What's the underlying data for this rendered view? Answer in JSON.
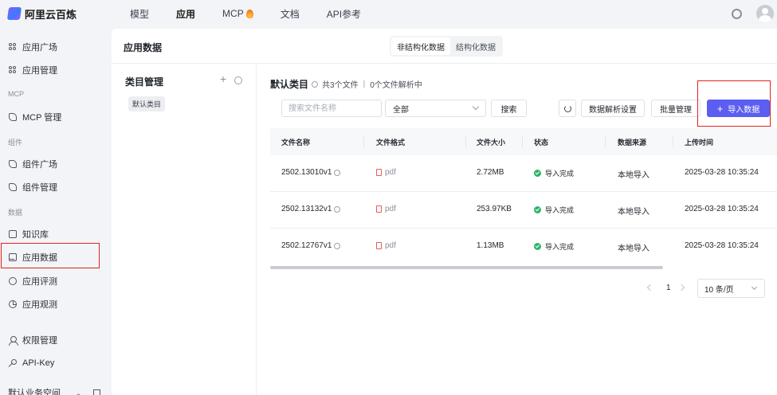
{
  "brand": {
    "name": "阿里云百炼"
  },
  "nav": {
    "items": [
      {
        "label": "模型",
        "active": false
      },
      {
        "label": "应用",
        "active": true
      },
      {
        "label": "MCP",
        "active": false
      },
      {
        "label": "文档",
        "active": false
      },
      {
        "label": "API参考",
        "active": false
      }
    ]
  },
  "sidebar": {
    "app_square": "应用广场",
    "app_manage": "应用管理",
    "section_mcp": "MCP",
    "mcp_manage": "MCP 管理",
    "section_component": "组件",
    "component_square": "组件广场",
    "component_manage": "组件管理",
    "section_data": "数据",
    "knowledge": "知识库",
    "app_data": "应用数据",
    "app_eval": "应用评测",
    "app_observe": "应用观测",
    "permission": "权限管理",
    "api_key": "API-Key",
    "workspace": "默认业务空间"
  },
  "main": {
    "title": "应用数据",
    "tabs": [
      {
        "label": "非结构化数据",
        "active": true
      },
      {
        "label": "结构化数据",
        "active": false
      }
    ]
  },
  "category": {
    "title": "类目管理",
    "add": "+",
    "default_tag": "默认类目"
  },
  "content": {
    "current_category": "默认类目",
    "file_count": "共3个文件",
    "parsing_count": "0个文件解析中",
    "search_placeholder": "搜索文件名称",
    "filter_value": "全部",
    "search_button": "搜索",
    "parse_settings_button": "数据解析设置",
    "batch_button": "批量管理",
    "import_button": "导入数据"
  },
  "table": {
    "columns": [
      "文件名称",
      "文件格式",
      "文件大小",
      "状态",
      "数据来源",
      "上传时间"
    ],
    "rows": [
      {
        "name": "2502.13010v1",
        "format": "pdf",
        "size": "2.72MB",
        "status": "导入完成",
        "source": "本地导入",
        "uploaded": "2025-03-28 10:35:24"
      },
      {
        "name": "2502.13132v1",
        "format": "pdf",
        "size": "253.97KB",
        "status": "导入完成",
        "source": "本地导入",
        "uploaded": "2025-03-28 10:35:24"
      },
      {
        "name": "2502.12767v1",
        "format": "pdf",
        "size": "1.13MB",
        "status": "导入完成",
        "source": "本地导入",
        "uploaded": "2025-03-28 10:35:24"
      }
    ]
  },
  "pagination": {
    "current_page": "1",
    "page_size": "10 条/页"
  },
  "colors": {
    "primary": "#5b5ef0",
    "success": "#2fb36b",
    "highlight": "#e02020"
  }
}
